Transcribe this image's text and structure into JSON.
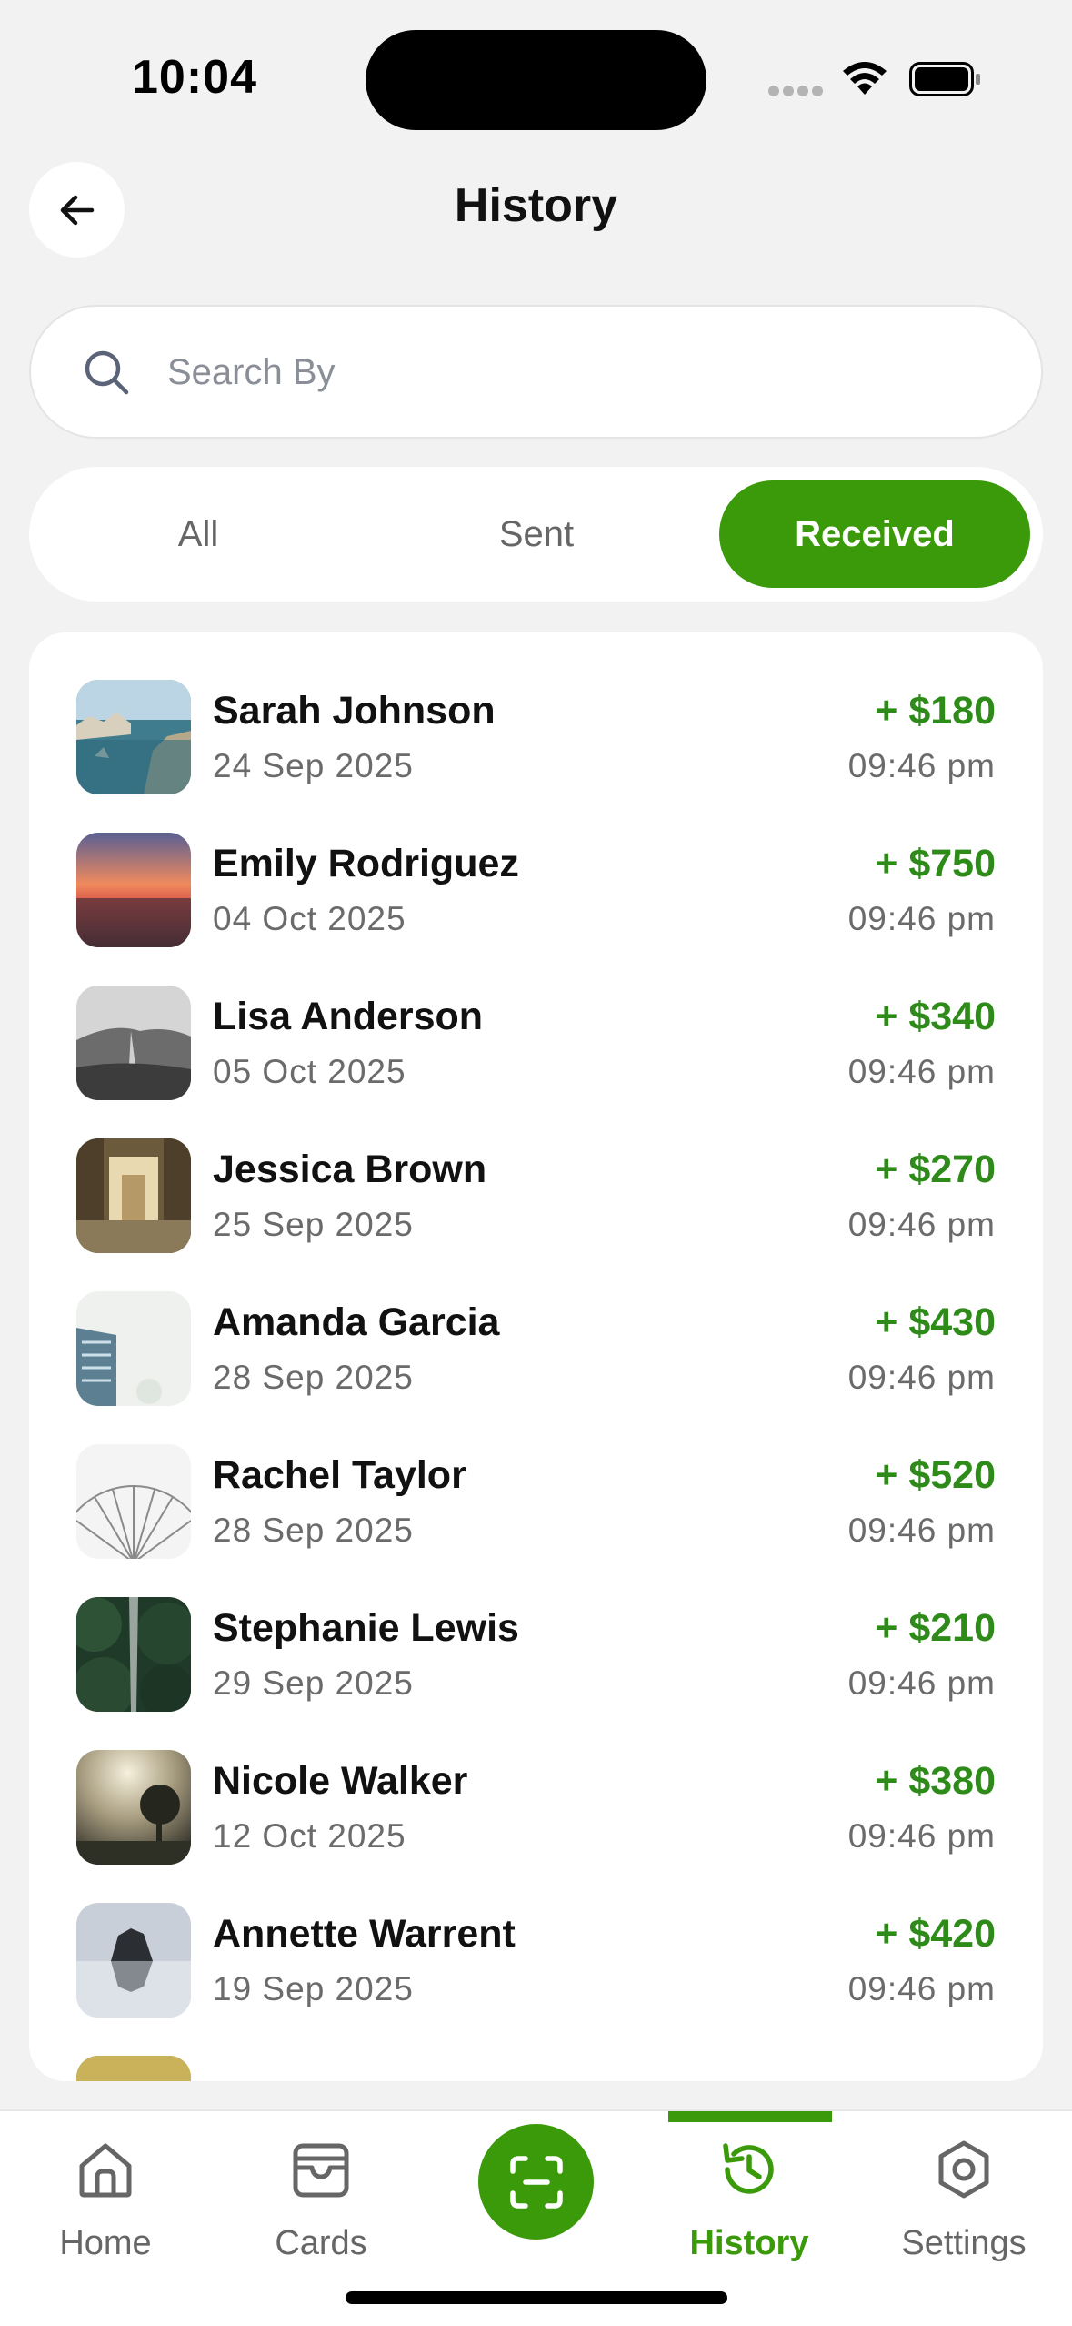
{
  "status_bar": {
    "time": "10:04"
  },
  "header": {
    "title": "History",
    "back_icon": "arrow-left-icon"
  },
  "search": {
    "placeholder": "Search By",
    "value": "",
    "icon": "search-icon"
  },
  "tabs": [
    {
      "label": "All",
      "active": false
    },
    {
      "label": "Sent",
      "active": false
    },
    {
      "label": "Received",
      "active": true
    }
  ],
  "transactions": [
    {
      "name": "Sarah Johnson",
      "date": "24 Sep 2025",
      "amount": "+ $180",
      "time": "09:46 pm"
    },
    {
      "name": "Emily Rodriguez",
      "date": "04 Oct 2025",
      "amount": "+ $750",
      "time": "09:46 pm"
    },
    {
      "name": "Lisa Anderson",
      "date": "05 Oct 2025",
      "amount": "+ $340",
      "time": "09:46 pm"
    },
    {
      "name": "Jessica Brown",
      "date": "25 Sep 2025",
      "amount": "+ $270",
      "time": "09:46 pm"
    },
    {
      "name": "Amanda Garcia",
      "date": "28 Sep 2025",
      "amount": "+ $430",
      "time": "09:46 pm"
    },
    {
      "name": "Rachel Taylor",
      "date": "28 Sep 2025",
      "amount": "+ $520",
      "time": "09:46 pm"
    },
    {
      "name": "Stephanie Lewis",
      "date": "29 Sep 2025",
      "amount": "+ $210",
      "time": "09:46 pm"
    },
    {
      "name": "Nicole Walker",
      "date": "12 Oct 2025",
      "amount": "+ $380",
      "time": "09:46 pm"
    },
    {
      "name": "Annette Warrent",
      "date": "19 Sep 2025",
      "amount": "+ $420",
      "time": "09:46 pm"
    }
  ],
  "bottom_nav": {
    "items": [
      {
        "label": "Home",
        "icon": "home-icon",
        "active": false
      },
      {
        "label": "Cards",
        "icon": "wallet-icon",
        "active": false
      },
      {
        "label": "History",
        "icon": "history-icon",
        "active": true
      },
      {
        "label": "Settings",
        "icon": "settings-icon",
        "active": false
      }
    ],
    "center_action_icon": "scan-icon"
  },
  "colors": {
    "accent": "#3a9a0a",
    "amount_positive": "#2e8b1a",
    "background": "#f2f2f2",
    "card": "#ffffff"
  }
}
